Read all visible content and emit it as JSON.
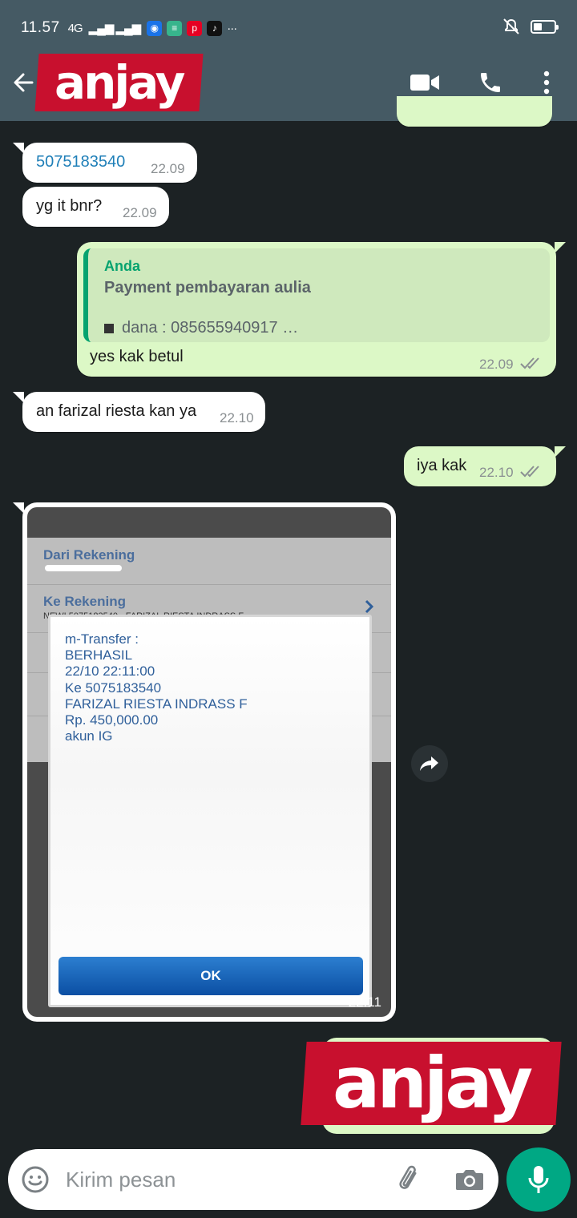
{
  "status_bar": {
    "time": "11.57",
    "network": "4G"
  },
  "header": {
    "logo_text": "anjay"
  },
  "messages": [
    {
      "direction": "in",
      "text": "5075183540",
      "time": "22.09"
    },
    {
      "direction": "in",
      "text": "yg it bnr?",
      "time": "22.09"
    },
    {
      "direction": "out",
      "reply": {
        "author": "Anda",
        "title": "Payment pembayaran aulia",
        "subtitle": "dana : 085655940917 …"
      },
      "text": "yes kak betul",
      "time": "22.09",
      "status": "read"
    },
    {
      "direction": "in",
      "text": "an farizal riesta kan ya",
      "time": "22.10"
    },
    {
      "direction": "out",
      "text": "iya kak",
      "time": "22.10",
      "status": "read"
    },
    {
      "direction": "in",
      "type": "image",
      "time": "22.11",
      "image": {
        "from_label": "Dari Rekening",
        "to_label": "Ke Rekening",
        "to_value": "NEW! 5075183540 - FARIZAL RIESTA INDRASS F",
        "dialog_lines": [
          "m-Transfer :",
          "BERHASIL",
          "22/10 22:11:00",
          "Ke 5075183540",
          "FARIZAL RIESTA INDRASS F",
          "Rp. 450,000.00",
          "akun IG"
        ],
        "ok_label": "OK"
      }
    },
    {
      "direction": "out",
      "type": "sticker",
      "text": "anjay"
    }
  ],
  "composer": {
    "placeholder": "Kirim pesan"
  },
  "colors": {
    "header_bg": "#455a64",
    "chat_bg": "#1c2224",
    "outgoing_bubble": "#dcf8c6",
    "accent_green": "#00a884",
    "logo_red": "#c8102e"
  },
  "icons": [
    "back-arrow-icon",
    "video-call-icon",
    "phone-icon",
    "more-vert-icon",
    "forward-icon",
    "emoji-icon",
    "attach-icon",
    "camera-icon",
    "mic-icon",
    "double-check-icon"
  ]
}
